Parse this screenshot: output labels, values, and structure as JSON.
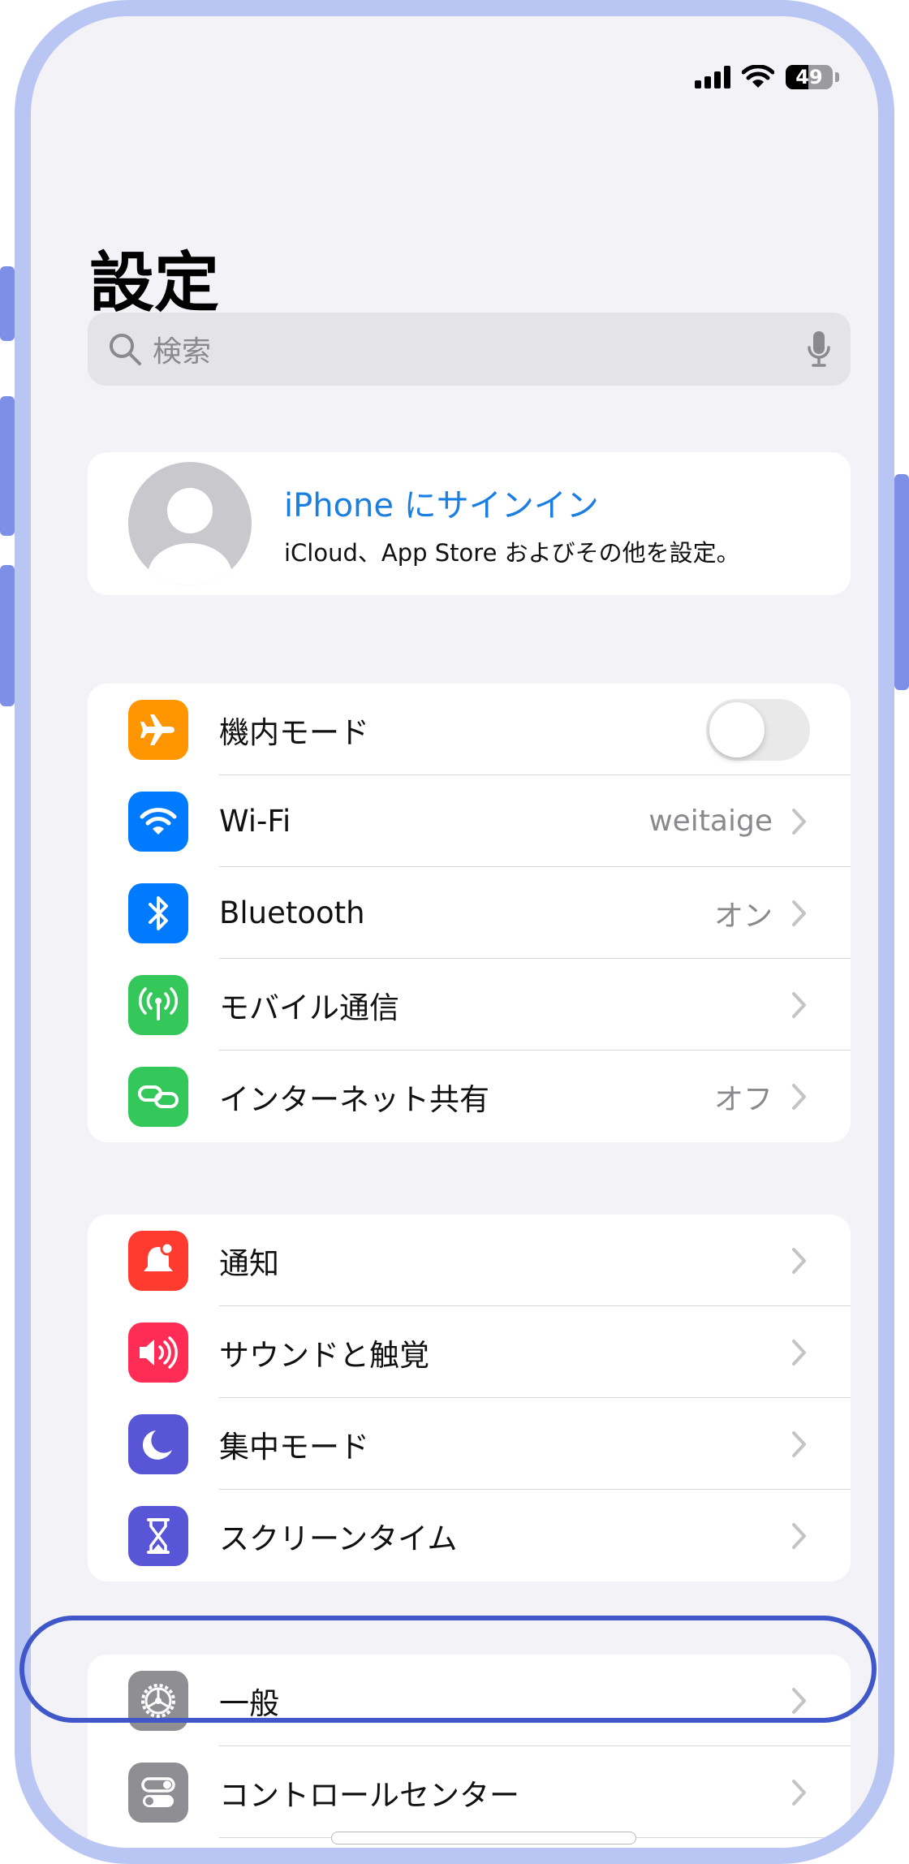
{
  "status": {
    "battery": "49"
  },
  "page": {
    "title": "設定"
  },
  "search": {
    "placeholder": "検索"
  },
  "profile": {
    "title": "iPhone にサインイン",
    "subtitle": "iCloud、App Store およびその他を設定。"
  },
  "network": {
    "airplane": {
      "label": "機内モード"
    },
    "wifi": {
      "label": "Wi-Fi",
      "value": "weitaige"
    },
    "bluetooth": {
      "label": "Bluetooth",
      "value": "オン"
    },
    "cellular": {
      "label": "モバイル通信"
    },
    "hotspot": {
      "label": "インターネット共有",
      "value": "オフ"
    }
  },
  "focus": {
    "notifications": {
      "label": "通知"
    },
    "sounds": {
      "label": "サウンドと触覚"
    },
    "focus_mode": {
      "label": "集中モード"
    },
    "screen_time": {
      "label": "スクリーンタイム"
    }
  },
  "general": {
    "general": {
      "label": "一般"
    },
    "control_center": {
      "label": "コントロールセンター"
    }
  },
  "colors": {
    "airplane": "#ff9500",
    "wifi": "#007aff",
    "bluetooth": "#007aff",
    "cellular": "#34c759",
    "hotspot": "#34c759",
    "notifications": "#ff3b30",
    "sounds": "#ff2d55",
    "focus": "#5856d6",
    "screen_time": "#5856d6",
    "general": "#8e8e93",
    "control_center": "#8e8e93",
    "link": "#1a7fe0",
    "highlight": "#3f57c9"
  }
}
